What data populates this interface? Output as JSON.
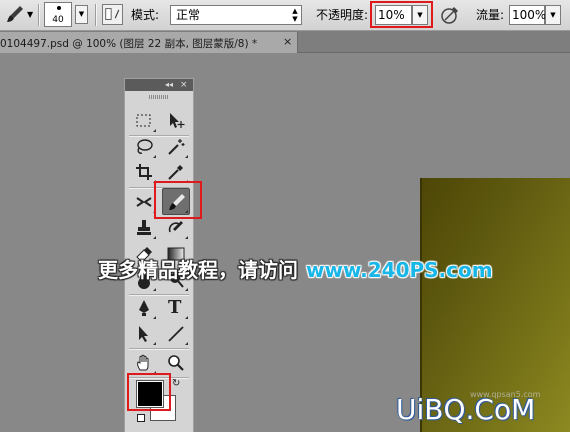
{
  "options_bar": {
    "brush_size": "40",
    "mode_label": "模式:",
    "mode_value": "正常",
    "opacity_label": "不透明度:",
    "opacity_value": "10%",
    "flow_label": "流量:",
    "flow_value": "100%",
    "highlight_color": "#e0191a"
  },
  "document_tab": {
    "title": "0104497.psd @ 100% (图层 22 副本, 图层蒙版/8) *",
    "close_glyph": "×"
  },
  "tools_panel": {
    "collapse_glyph": "◂◂",
    "close_glyph": "×",
    "tools": [
      {
        "icon": "rectangular-marquee-icon"
      },
      {
        "icon": "move-icon"
      },
      {
        "icon": "lasso-icon"
      },
      {
        "icon": "magic-wand-icon"
      },
      {
        "icon": "crop-icon"
      },
      {
        "icon": "eyedropper-icon"
      },
      {
        "icon": "healing-brush-icon"
      },
      {
        "icon": "brush-icon",
        "active": true
      },
      {
        "icon": "clone-stamp-icon"
      },
      {
        "icon": "history-brush-icon"
      },
      {
        "icon": "eraser-icon"
      },
      {
        "icon": "gradient-icon"
      },
      {
        "icon": "blur-icon"
      },
      {
        "icon": "dodge-icon"
      },
      {
        "icon": "pen-icon"
      },
      {
        "icon": "type-icon",
        "glyph": "T"
      },
      {
        "icon": "path-selection-icon"
      },
      {
        "icon": "line-icon"
      },
      {
        "icon": "hand-icon"
      },
      {
        "icon": "zoom-icon"
      }
    ],
    "foreground_color": "#000000",
    "background_color": "#ffffff"
  },
  "canvas": {
    "colors": [
      "#4d4606",
      "#8d8a22"
    ]
  },
  "overlay": {
    "chinese_text": "更多精品教程，请访问",
    "url_text": "www.240PS.com",
    "url_color": "#19b6e8"
  },
  "watermark": {
    "logo_text": "UiBQ.CoM",
    "small_text": "www.qpsan5.com"
  }
}
